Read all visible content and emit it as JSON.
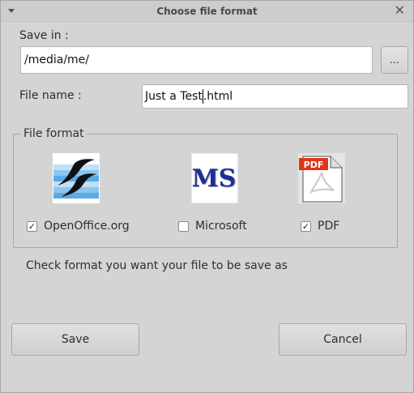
{
  "window": {
    "title": "Choose file format"
  },
  "save_in": {
    "label": "Save in :",
    "value": "/media/me/",
    "browse_label": "..."
  },
  "file_name": {
    "label": "File name :",
    "value_before_caret": "Just a Test",
    "value_after_caret": ".html"
  },
  "file_format": {
    "title": "File format",
    "options": [
      {
        "label": "OpenOffice.org",
        "checked": true,
        "icon": "openoffice-icon"
      },
      {
        "label": "Microsoft",
        "checked": false,
        "icon": "ms-icon",
        "icon_text": "MS"
      },
      {
        "label": "PDF",
        "checked": true,
        "icon": "pdf-icon",
        "icon_text": "PDF"
      }
    ]
  },
  "hint": "Check format you want your file to be save as",
  "buttons": {
    "save": "Save",
    "cancel": "Cancel"
  },
  "colors": {
    "ms_blue": "#1f2f8f",
    "pdf_red": "#e0361b",
    "oo_blue": "#2c86c8"
  }
}
